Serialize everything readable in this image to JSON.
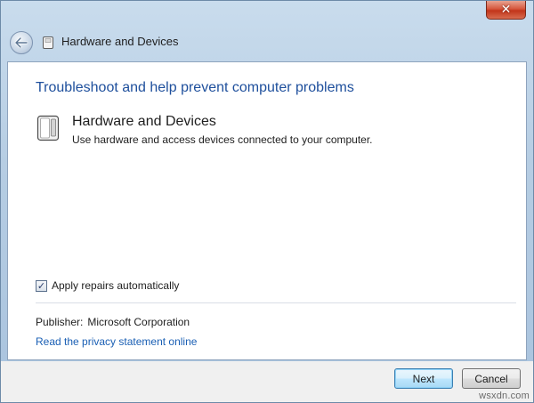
{
  "window": {
    "close_glyph": "✕",
    "accent_color": "#1e4f9c",
    "link_color": "#1a5fb4"
  },
  "nav": {
    "back_icon": "back-arrow-icon",
    "title": "Hardware and Devices"
  },
  "content": {
    "heading": "Troubleshoot and help prevent computer problems",
    "item": {
      "icon": "hardware-device-icon",
      "title": "Hardware and Devices",
      "description": "Use hardware and access devices connected to your computer."
    },
    "apply_repairs": {
      "label": "Apply repairs automatically",
      "checked": true,
      "check_glyph": "✓"
    },
    "publisher": {
      "label": "Publisher:",
      "value": "Microsoft Corporation"
    },
    "privacy_link": "Read the privacy statement online"
  },
  "footer": {
    "next_label": "Next",
    "cancel_label": "Cancel"
  },
  "watermark": "wsxdn.com"
}
